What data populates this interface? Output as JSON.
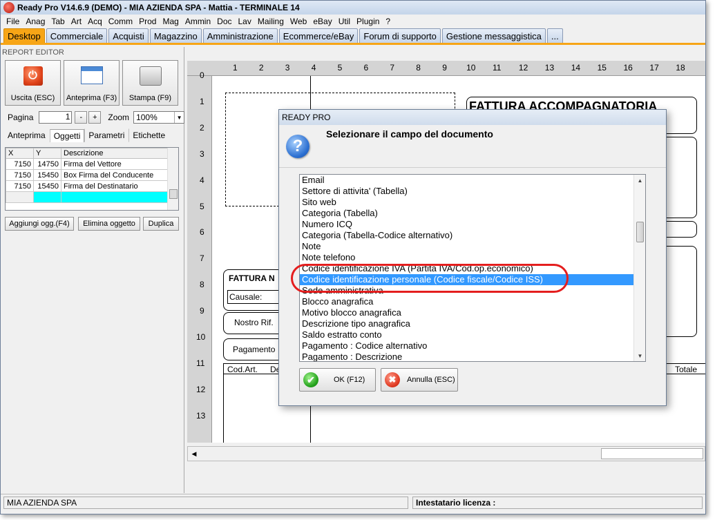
{
  "window": {
    "title": "Ready Pro V14.6.9 (DEMO) - MIA AZIENDA SPA - Mattia - TERMINALE 14"
  },
  "menu": [
    "File",
    "Anag",
    "Tab",
    "Art",
    "Acq",
    "Comm",
    "Prod",
    "Mag",
    "Ammin",
    "Doc",
    "Lav",
    "Mailing",
    "Web",
    "eBay",
    "Util",
    "Plugin",
    "?"
  ],
  "tabs": [
    "Desktop",
    "Commerciale",
    "Acquisti",
    "Magazzino",
    "Amministrazione",
    "Ecommerce/eBay",
    "Forum di supporto",
    "Gestione messaggistica",
    "..."
  ],
  "left": {
    "section_label": "REPORT EDITOR",
    "buttons": {
      "exit": "Uscita (ESC)",
      "preview": "Anteprima (F3)",
      "print": "Stampa (F9)"
    },
    "page_label": "Pagina",
    "page_value": "1",
    "minus": "-",
    "plus": "+",
    "zoom_label": "Zoom",
    "zoom_value": "100%",
    "subtabs": [
      "Anteprima",
      "Oggetti",
      "Parametri",
      "Etichette"
    ],
    "grid": {
      "headers": [
        "X",
        "Y",
        "Descrizione"
      ],
      "rows": [
        [
          "7150",
          "14750",
          "Firma del Vettore"
        ],
        [
          "7150",
          "15450",
          "Box Firma del Conducente"
        ],
        [
          "7150",
          "15450",
          "Firma del Destinatario"
        ]
      ]
    },
    "actions": {
      "add": "Aggiungi ogg.(F4)",
      "delete": "Elimina oggetto",
      "duplicate": "Duplica"
    }
  },
  "ruler": {
    "h": [
      "1",
      "2",
      "3",
      "4",
      "5",
      "6",
      "7",
      "8",
      "9",
      "10",
      "11",
      "12",
      "13",
      "14",
      "15",
      "16",
      "17",
      "18"
    ],
    "v": [
      "0",
      "1",
      "2",
      "3",
      "4",
      "5",
      "6",
      "7",
      "8",
      "9",
      "10",
      "11",
      "12",
      "13"
    ]
  },
  "document": {
    "title": "FATTURA ACCOMPAGNATORIA",
    "subtitle": "FATTURA N",
    "causale": "Causale:",
    "nostro_rif": "Nostro Rif.",
    "pagamento": "Pagamento",
    "cod_art": "Cod.Art.",
    "de": "De",
    "totale": "Totale"
  },
  "dialog": {
    "title": "READY PRO",
    "message": "Selezionare il campo del documento",
    "items": [
      "Email",
      "Settore di attivita' (Tabella)",
      "Sito web",
      "Categoria (Tabella)",
      "Numero ICQ",
      "Categoria (Tabella-Codice alternativo)",
      "Note",
      "Note telefono",
      "Codice identificazione IVA (Partita IVA/Cod.op.economico)",
      "Codice identificazione personale (Codice fiscale/Codice ISS)",
      "Sede amministrativa",
      "Blocco anagrafica",
      "Motivo blocco anagrafica",
      "Descrizione tipo anagrafica",
      "Saldo estratto conto",
      "Pagamento : Codice alternativo",
      "Pagamento : Descrizione"
    ],
    "selected_index": 9,
    "ok": "OK (F12)",
    "cancel": "Annulla (ESC)"
  },
  "status": {
    "company": "MIA AZIENDA SPA",
    "license_label": "Intestatario licenza :"
  }
}
